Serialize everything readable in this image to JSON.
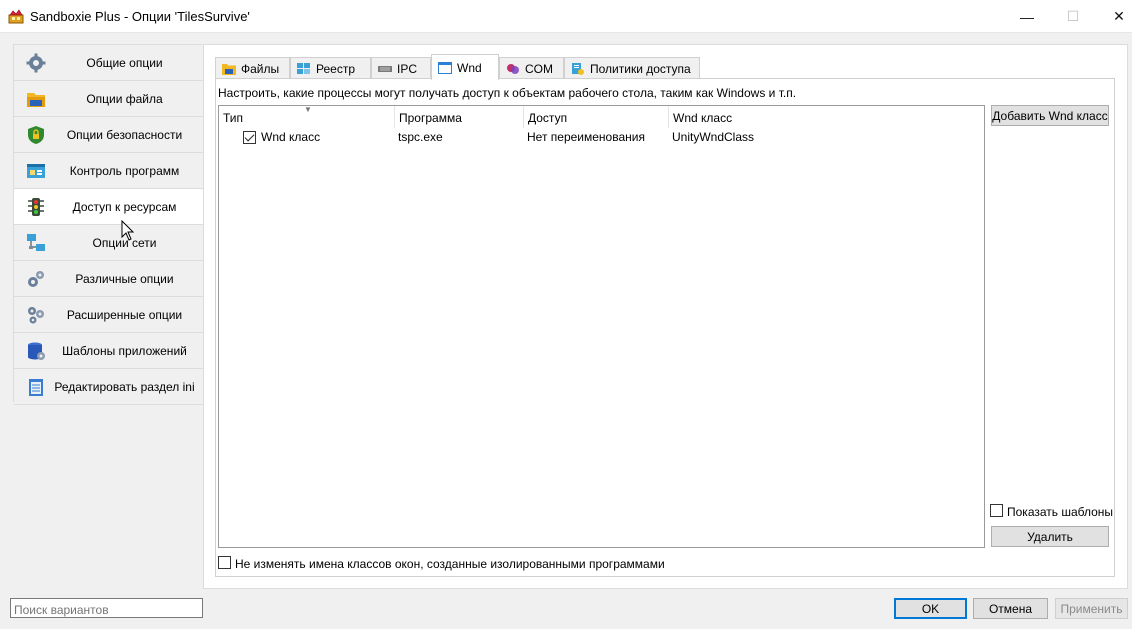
{
  "window": {
    "title": "Sandboxie Plus - Опции 'TilesSurvive'",
    "minimize": "—",
    "maximize": "☐",
    "close": "✕"
  },
  "sidebar": {
    "items": [
      {
        "label": "Общие опции",
        "icon": "gear-icon"
      },
      {
        "label": "Опции файла",
        "icon": "folder-icon"
      },
      {
        "label": "Опции безопасности",
        "icon": "shield-lock-icon"
      },
      {
        "label": "Контроль программ",
        "icon": "program-window-icon"
      },
      {
        "label": "Доступ к ресурсам",
        "icon": "traffic-light-icon"
      },
      {
        "label": "Опции сети",
        "icon": "network-icon"
      },
      {
        "label": "Различные опции",
        "icon": "gears-icon"
      },
      {
        "label": "Расширенные опции",
        "icon": "advanced-gears-icon"
      },
      {
        "label": "Шаблоны приложений",
        "icon": "database-icon"
      },
      {
        "label": "Редактировать раздел ini",
        "icon": "notepad-icon"
      }
    ],
    "active_index": 4
  },
  "tabs": [
    {
      "label": "Файлы",
      "icon": "folder-icon"
    },
    {
      "label": "Реестр",
      "icon": "registry-icon"
    },
    {
      "label": "IPC",
      "icon": "ipc-icon"
    },
    {
      "label": "Wnd",
      "icon": "window-icon"
    },
    {
      "label": "COM",
      "icon": "com-icon"
    },
    {
      "label": "Политики доступа",
      "icon": "policy-icon"
    }
  ],
  "active_tab": "Wnd",
  "description": "Настроить, какие процессы могут получать доступ к объектам рабочего стола, таким как Windows и т.п.",
  "table": {
    "columns": [
      "Тип",
      "Программа",
      "Доступ",
      "Wnd класс"
    ],
    "rows": [
      {
        "type": "Wnd класс",
        "program": "tspc.exe",
        "access": "Нет переименования",
        "wnd_class": "UnityWndClass",
        "checked": true
      }
    ]
  },
  "buttons": {
    "add_wnd_class": "Добавить Wnd класс",
    "delete": "Удалить",
    "ok": "OK",
    "cancel": "Отмена",
    "apply": "Применить"
  },
  "show_templates": {
    "label": "Показать шаблоны",
    "checked": false
  },
  "no_rename": {
    "label": "Не изменять имена классов окон, созданные изолированными программами",
    "checked": false
  },
  "search": {
    "placeholder": "Поиск вариантов"
  },
  "colors": {
    "accent": "#0078d7",
    "window_bg": "#f0f0f0",
    "panel_bg": "#ffffff"
  }
}
